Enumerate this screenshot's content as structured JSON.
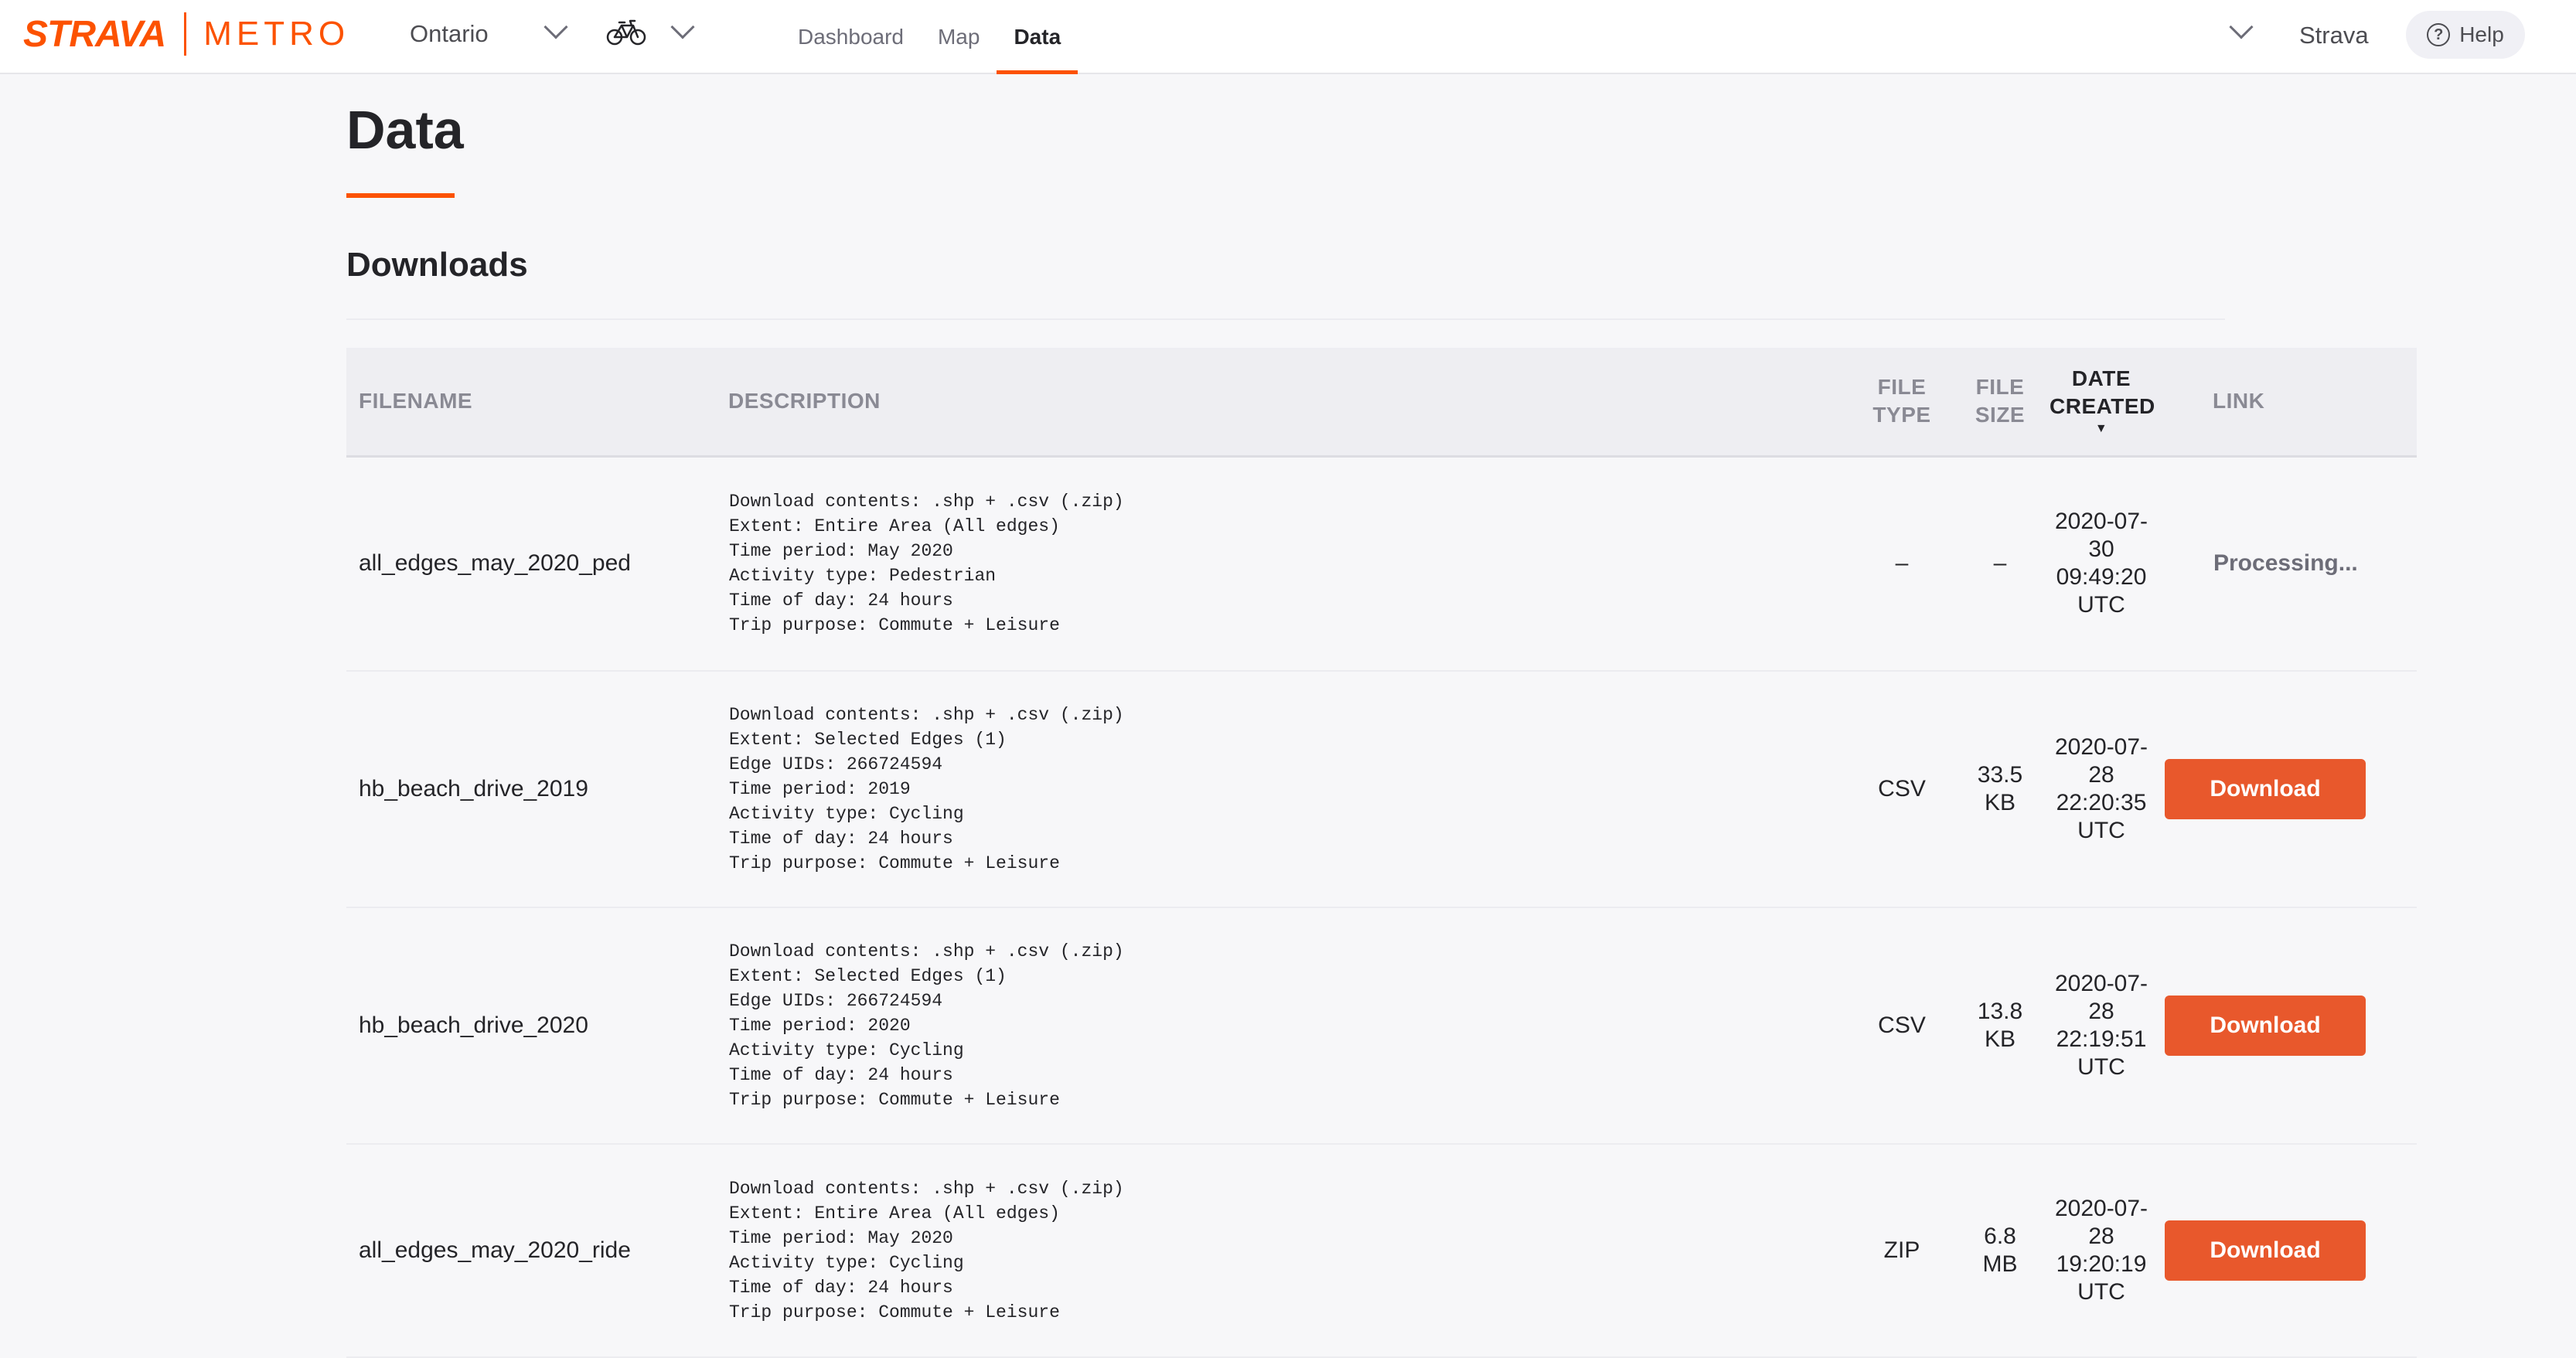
{
  "brand": {
    "logo_strava": "STRAVA",
    "logo_metro": "METRO",
    "accent_color": "#fc5200"
  },
  "topnav": {
    "region": "Ontario",
    "activity_icon": "bicycle-icon",
    "tabs": [
      {
        "label": "Dashboard",
        "active": false
      },
      {
        "label": "Map",
        "active": false
      },
      {
        "label": "Data",
        "active": true
      }
    ],
    "account_name": "Strava",
    "help_label": "Help",
    "help_icon": "question-circle-icon"
  },
  "page": {
    "title": "Data",
    "section_title": "Downloads"
  },
  "table": {
    "headers": {
      "filename": "FILENAME",
      "description": "DESCRIPTION",
      "file_type_1": "FILE",
      "file_type_2": "TYPE",
      "file_size_1": "FILE",
      "file_size_2": "SIZE",
      "date_created_1": "DATE",
      "date_created_2": "CREATED",
      "date_sort_indicator": "▼",
      "link": "LINK"
    },
    "rows": [
      {
        "filename": "all_edges_may_2020_ped",
        "description": "Download contents: .shp + .csv (.zip)\nExtent: Entire Area (All edges)\nTime period: May 2020\nActivity type: Pedestrian\nTime of day: 24 hours\nTrip purpose: Commute + Leisure",
        "file_type": "–",
        "file_size_1": "–",
        "file_size_2": "",
        "date_1": "2020-07-",
        "date_2": "30",
        "date_3": "09:49:20",
        "date_4": "UTC",
        "link_status": "Processing...",
        "link_label": ""
      },
      {
        "filename": "hb_beach_drive_2019",
        "description": "Download contents: .shp + .csv (.zip)\nExtent: Selected Edges (1)\nEdge UIDs: 266724594\nTime period: 2019\nActivity type: Cycling\nTime of day: 24 hours\nTrip purpose: Commute + Leisure",
        "file_type": "CSV",
        "file_size_1": "33.5",
        "file_size_2": "KB",
        "date_1": "2020-07-",
        "date_2": "28",
        "date_3": "22:20:35",
        "date_4": "UTC",
        "link_status": "",
        "link_label": "Download"
      },
      {
        "filename": "hb_beach_drive_2020",
        "description": "Download contents: .shp + .csv (.zip)\nExtent: Selected Edges (1)\nEdge UIDs: 266724594\nTime period: 2020\nActivity type: Cycling\nTime of day: 24 hours\nTrip purpose: Commute + Leisure",
        "file_type": "CSV",
        "file_size_1": "13.8",
        "file_size_2": "KB",
        "date_1": "2020-07-",
        "date_2": "28",
        "date_3": "22:19:51",
        "date_4": "UTC",
        "link_status": "",
        "link_label": "Download"
      },
      {
        "filename": "all_edges_may_2020_ride",
        "description": "Download contents: .shp + .csv (.zip)\nExtent: Entire Area (All edges)\nTime period: May 2020\nActivity type: Cycling\nTime of day: 24 hours\nTrip purpose: Commute + Leisure",
        "file_type": "ZIP",
        "file_size_1": "6.8",
        "file_size_2": "MB",
        "date_1": "2020-07-",
        "date_2": "28",
        "date_3": "19:20:19",
        "date_4": "UTC",
        "link_status": "",
        "link_label": "Download"
      }
    ]
  }
}
